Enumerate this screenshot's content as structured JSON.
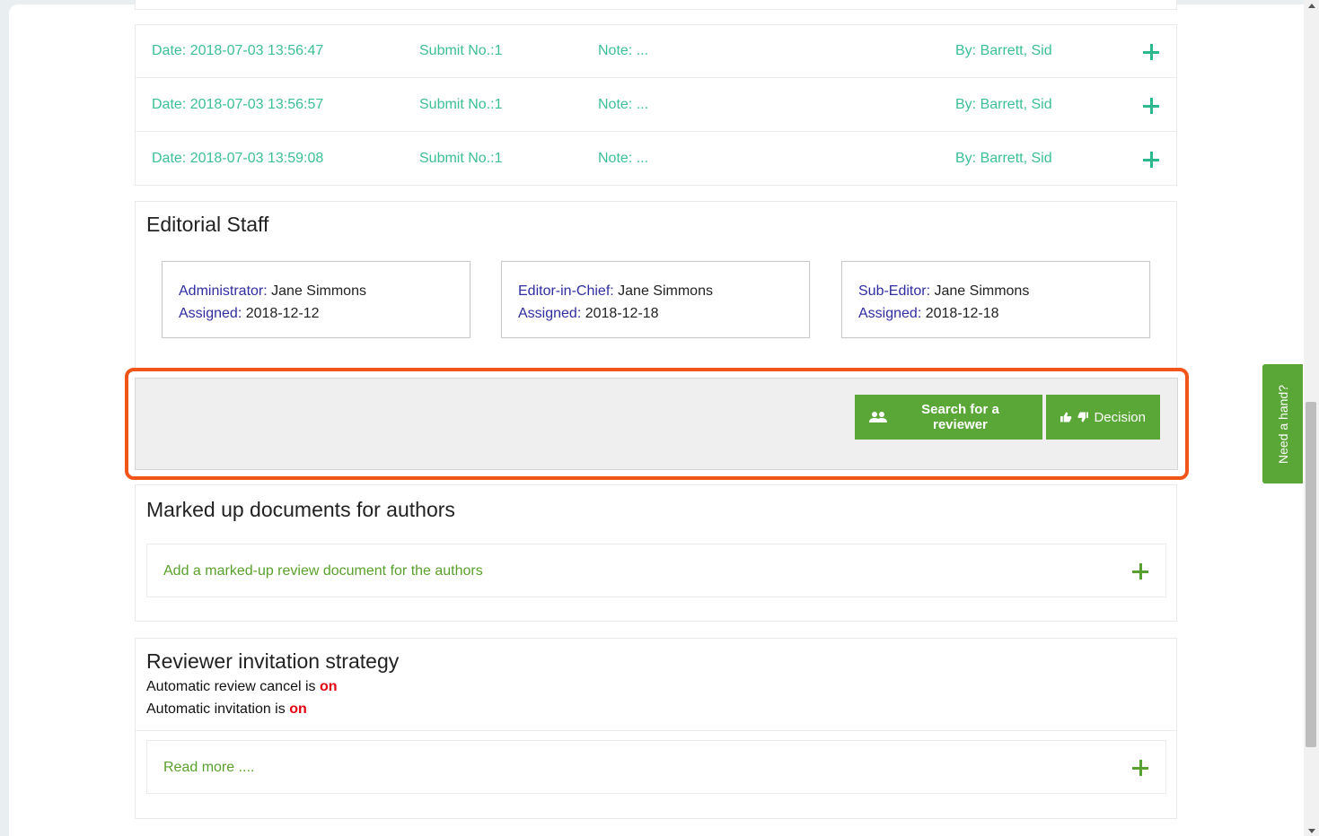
{
  "history": {
    "rows": [
      {
        "date": "Date: 2018-07-03 13:56:47",
        "submit": "Submit No.:1",
        "note": "Note: ...",
        "by": "By: Barrett, Sid"
      },
      {
        "date": "Date: 2018-07-03 13:56:57",
        "submit": "Submit No.:1",
        "note": "Note: ...",
        "by": "By: Barrett, Sid"
      },
      {
        "date": "Date: 2018-07-03 13:59:08",
        "submit": "Submit No.:1",
        "note": "Note: ...",
        "by": "By: Barrett, Sid"
      }
    ]
  },
  "editorial": {
    "title": "Editorial Staff",
    "cards": [
      {
        "role": "Administrator:",
        "name": "Jane Simmons",
        "assigned_label": "Assigned:",
        "assigned": "2018-12-12"
      },
      {
        "role": "Editor-in-Chief:",
        "name": "Jane Simmons",
        "assigned_label": "Assigned:",
        "assigned": "2018-12-18"
      },
      {
        "role": "Sub-Editor:",
        "name": "Jane Simmons",
        "assigned_label": "Assigned:",
        "assigned": "2018-12-18"
      }
    ]
  },
  "actions": {
    "search_reviewer": "Search for a reviewer",
    "decision": "Decision"
  },
  "marked_up": {
    "title": "Marked up documents for authors",
    "add_label": "Add a marked-up review document for the authors"
  },
  "strategy": {
    "title": "Reviewer invitation strategy",
    "cancel_text": "Automatic review cancel is",
    "cancel_value": "on",
    "invite_text": "Automatic invitation is",
    "invite_value": "on",
    "read_more": "Read more ...."
  },
  "help_tab": "Need a hand?",
  "colors": {
    "accent_green": "#5aa737",
    "teal_text": "#2cb88e",
    "highlight_outline": "#f2551a",
    "on_red": "#e3000f",
    "role_label": "#2f2da0"
  }
}
